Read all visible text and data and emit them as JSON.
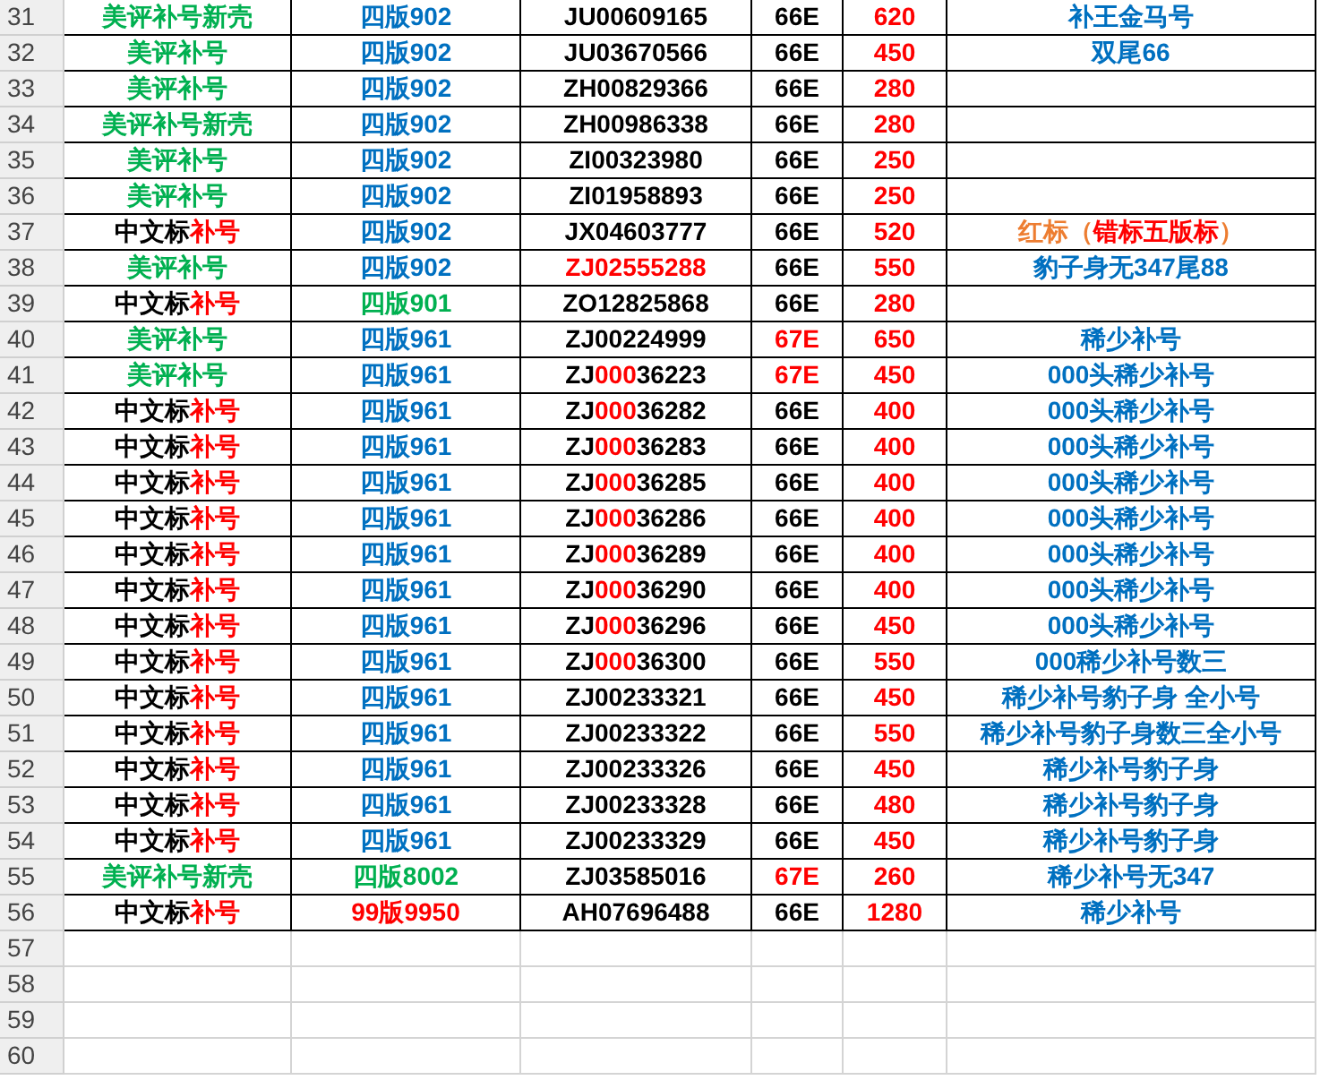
{
  "rows": [
    {
      "number": "31",
      "category": [
        {
          "text": "美评补号新壳",
          "color": "#00b050"
        }
      ],
      "version": [
        {
          "text": "四版902",
          "color": "#0070c0"
        }
      ],
      "serial": [
        {
          "text": "JU00609165",
          "color": "#000000"
        }
      ],
      "code": [
        {
          "text": "66E",
          "color": "#000000"
        }
      ],
      "price": [
        {
          "text": "620",
          "color": "#ff0000"
        }
      ],
      "note": [
        {
          "text": "补王金马号",
          "color": "#0070c0"
        }
      ]
    },
    {
      "number": "32",
      "category": [
        {
          "text": "美评补号",
          "color": "#00b050"
        }
      ],
      "version": [
        {
          "text": "四版902",
          "color": "#0070c0"
        }
      ],
      "serial": [
        {
          "text": "JU03670566",
          "color": "#000000"
        }
      ],
      "code": [
        {
          "text": "66E",
          "color": "#000000"
        }
      ],
      "price": [
        {
          "text": "450",
          "color": "#ff0000"
        }
      ],
      "note": [
        {
          "text": "双尾66",
          "color": "#0070c0"
        }
      ]
    },
    {
      "number": "33",
      "category": [
        {
          "text": "美评补号",
          "color": "#00b050"
        }
      ],
      "version": [
        {
          "text": "四版902",
          "color": "#0070c0"
        }
      ],
      "serial": [
        {
          "text": "ZH00829366",
          "color": "#000000"
        }
      ],
      "code": [
        {
          "text": "66E",
          "color": "#000000"
        }
      ],
      "price": [
        {
          "text": "280",
          "color": "#ff0000"
        }
      ]
    },
    {
      "number": "34",
      "category": [
        {
          "text": "美评补号新壳",
          "color": "#00b050"
        }
      ],
      "version": [
        {
          "text": "四版902",
          "color": "#0070c0"
        }
      ],
      "serial": [
        {
          "text": "ZH00986338",
          "color": "#000000"
        }
      ],
      "code": [
        {
          "text": "66E",
          "color": "#000000"
        }
      ],
      "price": [
        {
          "text": "280",
          "color": "#ff0000"
        }
      ]
    },
    {
      "number": "35",
      "category": [
        {
          "text": "美评补号",
          "color": "#00b050"
        }
      ],
      "version": [
        {
          "text": "四版902",
          "color": "#0070c0"
        }
      ],
      "serial": [
        {
          "text": "ZI00323980",
          "color": "#000000"
        }
      ],
      "code": [
        {
          "text": "66E",
          "color": "#000000"
        }
      ],
      "price": [
        {
          "text": "250",
          "color": "#ff0000"
        }
      ]
    },
    {
      "number": "36",
      "category": [
        {
          "text": "美评补号",
          "color": "#00b050"
        }
      ],
      "version": [
        {
          "text": "四版902",
          "color": "#0070c0"
        }
      ],
      "serial": [
        {
          "text": "ZI01958893",
          "color": "#000000"
        }
      ],
      "code": [
        {
          "text": "66E",
          "color": "#000000"
        }
      ],
      "price": [
        {
          "text": "250",
          "color": "#ff0000"
        }
      ]
    },
    {
      "number": "37",
      "category": [
        {
          "text": "中文标",
          "color": "#000000"
        },
        {
          "text": "补号",
          "color": "#ff0000"
        }
      ],
      "version": [
        {
          "text": "四版902",
          "color": "#0070c0"
        }
      ],
      "serial": [
        {
          "text": "JX04603777",
          "color": "#000000"
        }
      ],
      "code": [
        {
          "text": "66E",
          "color": "#000000"
        }
      ],
      "price": [
        {
          "text": "520",
          "color": "#ff0000"
        }
      ],
      "note": [
        {
          "text": "红标（",
          "color": "#ed7d31"
        },
        {
          "text": "错标五版标",
          "color": "#ff0000"
        },
        {
          "text": "）",
          "color": "#ed7d31"
        }
      ]
    },
    {
      "number": "38",
      "category": [
        {
          "text": "美评补号",
          "color": "#00b050"
        }
      ],
      "version": [
        {
          "text": "四版902",
          "color": "#0070c0"
        }
      ],
      "serial": [
        {
          "text": "ZJ02555288",
          "color": "#ff0000"
        }
      ],
      "code": [
        {
          "text": "66E",
          "color": "#000000"
        }
      ],
      "price": [
        {
          "text": "550",
          "color": "#ff0000"
        }
      ],
      "note": [
        {
          "text": "豹子身无347尾88",
          "color": "#0070c0"
        }
      ]
    },
    {
      "number": "39",
      "category": [
        {
          "text": "中文标",
          "color": "#000000"
        },
        {
          "text": "补号",
          "color": "#ff0000"
        }
      ],
      "version": [
        {
          "text": "四版901",
          "color": "#00b050"
        }
      ],
      "serial": [
        {
          "text": "ZO12825868",
          "color": "#000000"
        }
      ],
      "code": [
        {
          "text": "66E",
          "color": "#000000"
        }
      ],
      "price": [
        {
          "text": "280",
          "color": "#ff0000"
        }
      ]
    },
    {
      "number": "40",
      "category": [
        {
          "text": "美评补号",
          "color": "#00b050"
        }
      ],
      "version": [
        {
          "text": "四版961",
          "color": "#0070c0"
        }
      ],
      "serial": [
        {
          "text": "ZJ00224999",
          "color": "#000000"
        }
      ],
      "code": [
        {
          "text": "67E",
          "color": "#ff0000"
        }
      ],
      "price": [
        {
          "text": "650",
          "color": "#ff0000"
        }
      ],
      "note": [
        {
          "text": "稀少补号",
          "color": "#0070c0"
        }
      ]
    },
    {
      "number": "41",
      "category": [
        {
          "text": "美评补号",
          "color": "#00b050"
        }
      ],
      "version": [
        {
          "text": "四版961",
          "color": "#0070c0"
        }
      ],
      "serial": [
        {
          "text": "ZJ",
          "color": "#000000"
        },
        {
          "text": "000",
          "color": "#ff0000"
        },
        {
          "text": "36223",
          "color": "#000000"
        }
      ],
      "code": [
        {
          "text": "67E",
          "color": "#ff0000"
        }
      ],
      "price": [
        {
          "text": "450",
          "color": "#ff0000"
        }
      ],
      "note": [
        {
          "text": "000头稀少补号",
          "color": "#0070c0"
        }
      ]
    },
    {
      "number": "42",
      "category": [
        {
          "text": "中文标",
          "color": "#000000"
        },
        {
          "text": "补号",
          "color": "#ff0000"
        }
      ],
      "version": [
        {
          "text": "四版961",
          "color": "#0070c0"
        }
      ],
      "serial": [
        {
          "text": "ZJ",
          "color": "#000000"
        },
        {
          "text": "000",
          "color": "#ff0000"
        },
        {
          "text": "36282",
          "color": "#000000"
        }
      ],
      "code": [
        {
          "text": "66E",
          "color": "#000000"
        }
      ],
      "price": [
        {
          "text": "400",
          "color": "#ff0000"
        }
      ],
      "note": [
        {
          "text": "000头稀少补号",
          "color": "#0070c0"
        }
      ]
    },
    {
      "number": "43",
      "category": [
        {
          "text": "中文标",
          "color": "#000000"
        },
        {
          "text": "补号",
          "color": "#ff0000"
        }
      ],
      "version": [
        {
          "text": "四版961",
          "color": "#0070c0"
        }
      ],
      "serial": [
        {
          "text": "ZJ",
          "color": "#000000"
        },
        {
          "text": "000",
          "color": "#ff0000"
        },
        {
          "text": "36283",
          "color": "#000000"
        }
      ],
      "code": [
        {
          "text": "66E",
          "color": "#000000"
        }
      ],
      "price": [
        {
          "text": "400",
          "color": "#ff0000"
        }
      ],
      "note": [
        {
          "text": "000头稀少补号",
          "color": "#0070c0"
        }
      ]
    },
    {
      "number": "44",
      "category": [
        {
          "text": "中文标",
          "color": "#000000"
        },
        {
          "text": "补号",
          "color": "#ff0000"
        }
      ],
      "version": [
        {
          "text": "四版961",
          "color": "#0070c0"
        }
      ],
      "serial": [
        {
          "text": "ZJ",
          "color": "#000000"
        },
        {
          "text": "000",
          "color": "#ff0000"
        },
        {
          "text": "36285",
          "color": "#000000"
        }
      ],
      "code": [
        {
          "text": "66E",
          "color": "#000000"
        }
      ],
      "price": [
        {
          "text": "400",
          "color": "#ff0000"
        }
      ],
      "note": [
        {
          "text": "000头稀少补号",
          "color": "#0070c0"
        }
      ]
    },
    {
      "number": "45",
      "category": [
        {
          "text": "中文标",
          "color": "#000000"
        },
        {
          "text": "补号",
          "color": "#ff0000"
        }
      ],
      "version": [
        {
          "text": "四版961",
          "color": "#0070c0"
        }
      ],
      "serial": [
        {
          "text": "ZJ",
          "color": "#000000"
        },
        {
          "text": "000",
          "color": "#ff0000"
        },
        {
          "text": "36286",
          "color": "#000000"
        }
      ],
      "code": [
        {
          "text": "66E",
          "color": "#000000"
        }
      ],
      "price": [
        {
          "text": "400",
          "color": "#ff0000"
        }
      ],
      "note": [
        {
          "text": "000头稀少补号",
          "color": "#0070c0"
        }
      ]
    },
    {
      "number": "46",
      "category": [
        {
          "text": "中文标",
          "color": "#000000"
        },
        {
          "text": "补号",
          "color": "#ff0000"
        }
      ],
      "version": [
        {
          "text": "四版961",
          "color": "#0070c0"
        }
      ],
      "serial": [
        {
          "text": "ZJ",
          "color": "#000000"
        },
        {
          "text": "000",
          "color": "#ff0000"
        },
        {
          "text": "36289",
          "color": "#000000"
        }
      ],
      "code": [
        {
          "text": "66E",
          "color": "#000000"
        }
      ],
      "price": [
        {
          "text": "400",
          "color": "#ff0000"
        }
      ],
      "note": [
        {
          "text": "000头稀少补号",
          "color": "#0070c0"
        }
      ]
    },
    {
      "number": "47",
      "category": [
        {
          "text": "中文标",
          "color": "#000000"
        },
        {
          "text": "补号",
          "color": "#ff0000"
        }
      ],
      "version": [
        {
          "text": "四版961",
          "color": "#0070c0"
        }
      ],
      "serial": [
        {
          "text": "ZJ",
          "color": "#000000"
        },
        {
          "text": "000",
          "color": "#ff0000"
        },
        {
          "text": "36290",
          "color": "#000000"
        }
      ],
      "code": [
        {
          "text": "66E",
          "color": "#000000"
        }
      ],
      "price": [
        {
          "text": "400",
          "color": "#ff0000"
        }
      ],
      "note": [
        {
          "text": "000头稀少补号",
          "color": "#0070c0"
        }
      ]
    },
    {
      "number": "48",
      "category": [
        {
          "text": "中文标",
          "color": "#000000"
        },
        {
          "text": "补号",
          "color": "#ff0000"
        }
      ],
      "version": [
        {
          "text": "四版961",
          "color": "#0070c0"
        }
      ],
      "serial": [
        {
          "text": "ZJ",
          "color": "#000000"
        },
        {
          "text": "000",
          "color": "#ff0000"
        },
        {
          "text": "36296",
          "color": "#000000"
        }
      ],
      "code": [
        {
          "text": "66E",
          "color": "#000000"
        }
      ],
      "price": [
        {
          "text": "450",
          "color": "#ff0000"
        }
      ],
      "note": [
        {
          "text": "000头稀少补号",
          "color": "#0070c0"
        }
      ]
    },
    {
      "number": "49",
      "category": [
        {
          "text": "中文标",
          "color": "#000000"
        },
        {
          "text": "补号",
          "color": "#ff0000"
        }
      ],
      "version": [
        {
          "text": "四版961",
          "color": "#0070c0"
        }
      ],
      "serial": [
        {
          "text": "ZJ",
          "color": "#000000"
        },
        {
          "text": "000",
          "color": "#ff0000"
        },
        {
          "text": "36300",
          "color": "#000000"
        }
      ],
      "code": [
        {
          "text": "66E",
          "color": "#000000"
        }
      ],
      "price": [
        {
          "text": "550",
          "color": "#ff0000"
        }
      ],
      "note": [
        {
          "text": "000稀少补号数三",
          "color": "#0070c0"
        }
      ]
    },
    {
      "number": "50",
      "category": [
        {
          "text": "中文标",
          "color": "#000000"
        },
        {
          "text": "补号",
          "color": "#ff0000"
        }
      ],
      "version": [
        {
          "text": "四版961",
          "color": "#0070c0"
        }
      ],
      "serial": [
        {
          "text": "ZJ00233321",
          "color": "#000000"
        }
      ],
      "code": [
        {
          "text": "66E",
          "color": "#000000"
        }
      ],
      "price": [
        {
          "text": "450",
          "color": "#ff0000"
        }
      ],
      "note": [
        {
          "text": "稀少补号豹子身 全小号",
          "color": "#0070c0"
        }
      ]
    },
    {
      "number": "51",
      "category": [
        {
          "text": "中文标",
          "color": "#000000"
        },
        {
          "text": "补号",
          "color": "#ff0000"
        }
      ],
      "version": [
        {
          "text": "四版961",
          "color": "#0070c0"
        }
      ],
      "serial": [
        {
          "text": "ZJ00233322",
          "color": "#000000"
        }
      ],
      "code": [
        {
          "text": "66E",
          "color": "#000000"
        }
      ],
      "price": [
        {
          "text": "550",
          "color": "#ff0000"
        }
      ],
      "note": [
        {
          "text": "稀少补号豹子身数三全小号",
          "color": "#0070c0"
        }
      ]
    },
    {
      "number": "52",
      "category": [
        {
          "text": "中文标",
          "color": "#000000"
        },
        {
          "text": "补号",
          "color": "#ff0000"
        }
      ],
      "version": [
        {
          "text": "四版961",
          "color": "#0070c0"
        }
      ],
      "serial": [
        {
          "text": "ZJ00233326",
          "color": "#000000"
        }
      ],
      "code": [
        {
          "text": "66E",
          "color": "#000000"
        }
      ],
      "price": [
        {
          "text": "450",
          "color": "#ff0000"
        }
      ],
      "note": [
        {
          "text": "稀少补号豹子身",
          "color": "#0070c0"
        }
      ]
    },
    {
      "number": "53",
      "category": [
        {
          "text": "中文标",
          "color": "#000000"
        },
        {
          "text": "补号",
          "color": "#ff0000"
        }
      ],
      "version": [
        {
          "text": "四版961",
          "color": "#0070c0"
        }
      ],
      "serial": [
        {
          "text": "ZJ00233328",
          "color": "#000000"
        }
      ],
      "code": [
        {
          "text": "66E",
          "color": "#000000"
        }
      ],
      "price": [
        {
          "text": "480",
          "color": "#ff0000"
        }
      ],
      "note": [
        {
          "text": "稀少补号豹子身",
          "color": "#0070c0"
        }
      ]
    },
    {
      "number": "54",
      "category": [
        {
          "text": "中文标",
          "color": "#000000"
        },
        {
          "text": "补号",
          "color": "#ff0000"
        }
      ],
      "version": [
        {
          "text": "四版961",
          "color": "#0070c0"
        }
      ],
      "serial": [
        {
          "text": "ZJ00233329",
          "color": "#000000"
        }
      ],
      "code": [
        {
          "text": "66E",
          "color": "#000000"
        }
      ],
      "price": [
        {
          "text": "450",
          "color": "#ff0000"
        }
      ],
      "note": [
        {
          "text": "稀少补号豹子身",
          "color": "#0070c0"
        }
      ]
    },
    {
      "number": "55",
      "category": [
        {
          "text": "美评补号新壳",
          "color": "#00b050"
        }
      ],
      "version": [
        {
          "text": "四版8002",
          "color": "#00b050"
        }
      ],
      "serial": [
        {
          "text": "ZJ03585016",
          "color": "#000000"
        }
      ],
      "code": [
        {
          "text": "67E",
          "color": "#ff0000"
        }
      ],
      "price": [
        {
          "text": "260",
          "color": "#ff0000"
        }
      ],
      "note": [
        {
          "text": "稀少补号无347",
          "color": "#0070c0"
        }
      ]
    },
    {
      "number": "56",
      "category": [
        {
          "text": "中文标",
          "color": "#000000"
        },
        {
          "text": "补号",
          "color": "#ff0000"
        }
      ],
      "version": [
        {
          "text": "99版9950",
          "color": "#ff0000"
        }
      ],
      "serial": [
        {
          "text": "AH07696488",
          "color": "#000000"
        }
      ],
      "code": [
        {
          "text": "66E",
          "color": "#000000"
        }
      ],
      "price": [
        {
          "text": "1280",
          "color": "#ff0000"
        }
      ],
      "note": [
        {
          "text": "稀少补号",
          "color": "#0070c0"
        }
      ]
    },
    {
      "number": "57"
    },
    {
      "number": "58"
    },
    {
      "number": "59"
    },
    {
      "number": "60"
    }
  ]
}
